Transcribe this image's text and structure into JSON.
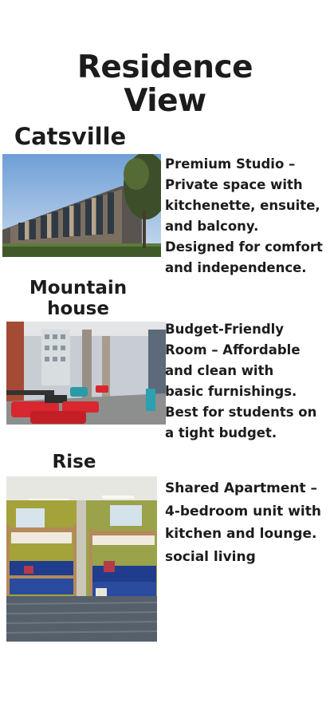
{
  "page": {
    "title_line1": "Residence",
    "title_line2": "View"
  },
  "residences": [
    {
      "name_line1": "Catsville",
      "description_lines": [
        "Premium Studio –",
        "Private space with",
        "kitchenette, ensuite,",
        "and balcony.",
        "Designed for comfort",
        "and independence."
      ]
    },
    {
      "name_line1": "Mountain",
      "name_line2": "house",
      "description_lines": [
        "Budget-Friendly",
        "Room – Affordable",
        "and clean with",
        "basic furnishings.",
        "Best for students on",
        "a tight budget."
      ]
    },
    {
      "name_line1": "Rise",
      "description_lines": [
        "Shared Apartment –",
        "4-bedroom unit with",
        "kitchen and lounge.",
        "social living"
      ]
    }
  ],
  "colors": {
    "text": "#1c1c1c",
    "background": "#ffffff"
  }
}
